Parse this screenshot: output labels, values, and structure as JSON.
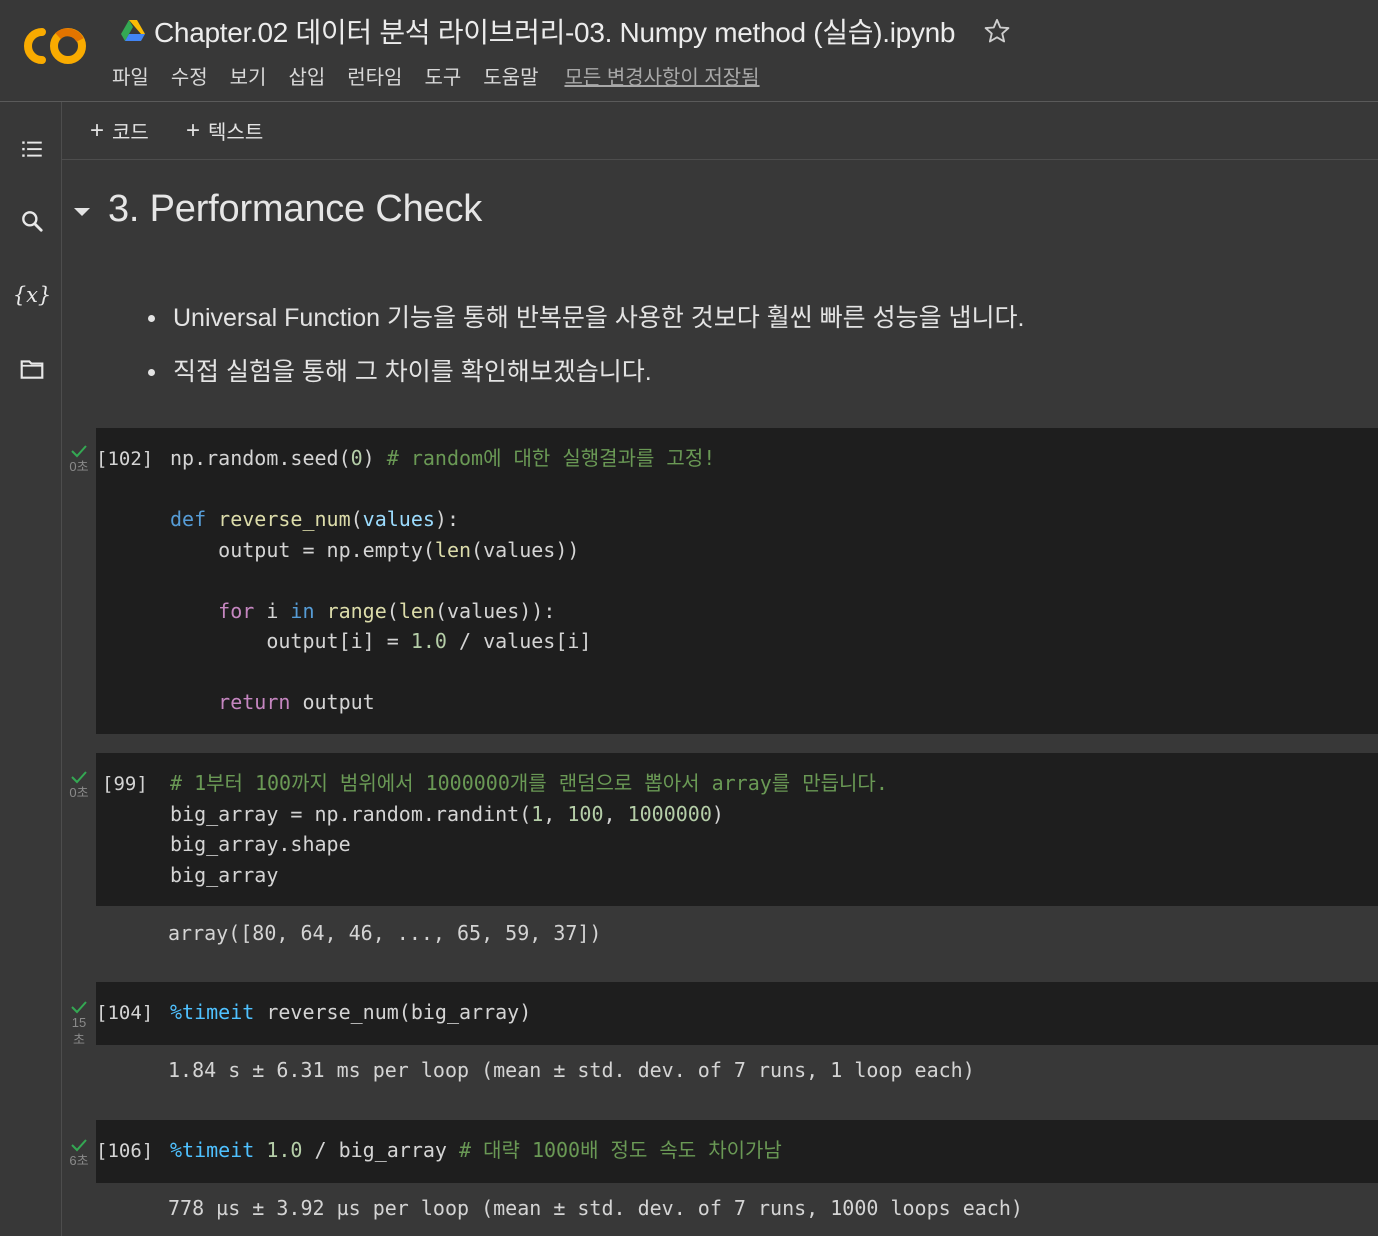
{
  "header": {
    "logo_text": "CO",
    "notebook_title": "Chapter.02 데이터 분석 라이브러리-03. Numpy method (실습).ipynb",
    "menu": [
      "파일",
      "수정",
      "보기",
      "삽입",
      "런타임",
      "도구",
      "도움말"
    ],
    "save_status": "모든 변경사항이 저장됨"
  },
  "sidebar": {
    "items": [
      {
        "name": "table-of-contents-icon"
      },
      {
        "name": "search-icon"
      },
      {
        "name": "variables-icon",
        "label": "{x}"
      },
      {
        "name": "files-icon"
      }
    ]
  },
  "toolbar": {
    "add_code": "코드",
    "add_text": "텍스트"
  },
  "section": {
    "heading": "3.  Performance Check",
    "bullets": [
      "Universal Function 기능을 통해 반복문을 사용한 것보다 훨씬 빠른 성능을 냅니다.",
      "직접 실험을 통해 그 차이를 확인해보겠습니다."
    ]
  },
  "cells": [
    {
      "prompt": "[102]",
      "exec_time": "0초",
      "code": [
        "np.random.seed(0) # random에 대한 실행결과를 고정!",
        "",
        "def reverse_num(values):",
        "    output = np.empty(len(values))",
        "",
        "    for i in range(len(values)):",
        "        output[i] = 1.0 / values[i]",
        "",
        "    return output"
      ],
      "output": ""
    },
    {
      "prompt": "[99]",
      "exec_time": "0초",
      "code": [
        "# 1부터 100까지 범위에서 1000000개를 랜덤으로 뽑아서 array를 만듭니다.",
        "big_array = np.random.randint(1, 100, 1000000)",
        "big_array.shape",
        "big_array"
      ],
      "output": "array([80, 64, 46, ..., 65, 59, 37])"
    },
    {
      "prompt": "[104]",
      "exec_time": "15\n초",
      "code": [
        "%timeit reverse_num(big_array)"
      ],
      "output": "1.84 s ± 6.31 ms per loop (mean ± std. dev. of 7 runs, 1 loop each)"
    },
    {
      "prompt": "[106]",
      "exec_time": "6초",
      "code": [
        "%timeit 1.0 / big_array # 대략 1000배 정도 속도 차이가남"
      ],
      "output": "778 µs ± 3.92 µs per loop (mean ± std. dev. of 7 runs, 1000 loops each)"
    }
  ],
  "colors": {
    "status_check": "#34a853",
    "keyword": "#569cd6",
    "control": "#c586c0",
    "function": "#dcdcaa",
    "parameter": "#9cdcfe",
    "number": "#b5cea8",
    "comment": "#6a9955",
    "magic": "#4fc1ff"
  }
}
